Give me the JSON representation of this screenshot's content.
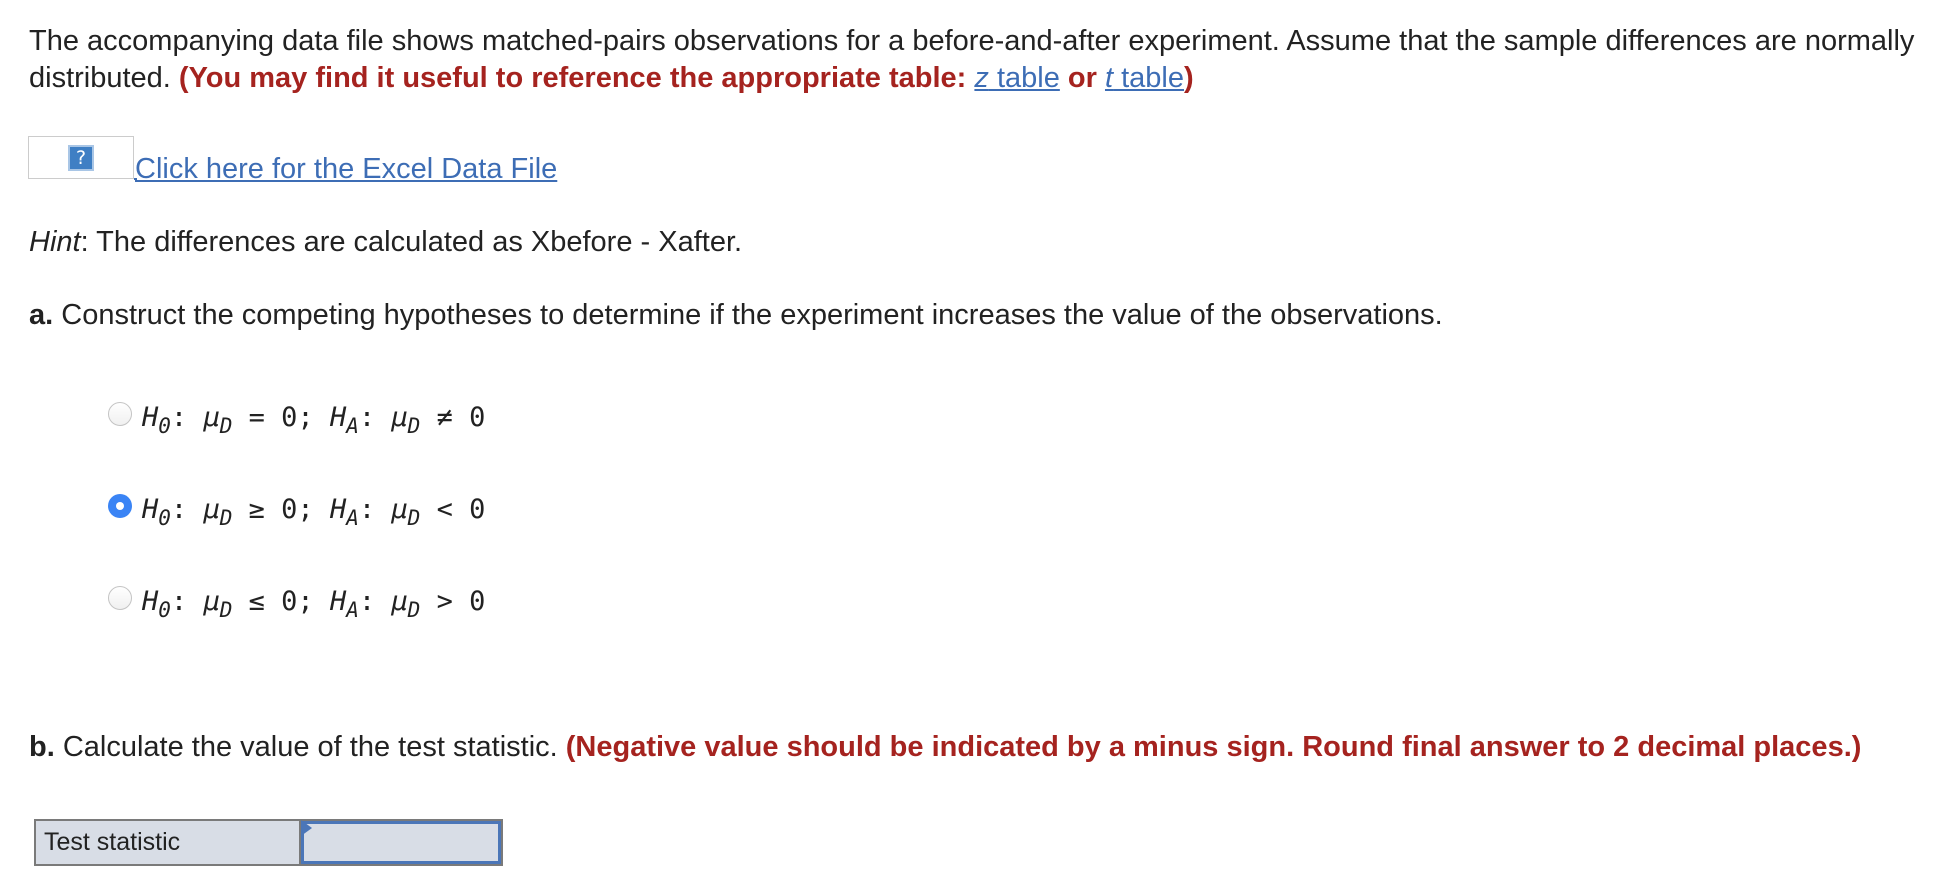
{
  "intro": {
    "text": "The accompanying data file shows matched-pairs observations for a before-and-after experiment. Assume that the sample differences are normally distributed. ",
    "note_prefix": "(You may find it useful to reference the appropriate table: ",
    "z_italic": "z",
    "z_link": " table",
    "or": " or ",
    "t_italic": "t",
    "t_link": " table",
    "note_suffix": ")"
  },
  "excel": {
    "icon": "?",
    "icon_name": "broken-image-icon",
    "link_label": "Click here for the Excel Data File"
  },
  "hint": {
    "label": "Hint",
    "text": ": The differences are calculated as Xbefore - Xafter."
  },
  "part_a": {
    "letter": "a.",
    "question": " Construct the competing hypotheses to determine if the experiment increases the value of the observations.",
    "selected_index": 1,
    "options": [
      {
        "h0_rel": "=",
        "ha_rel": "≠",
        "value": "0"
      },
      {
        "h0_rel": "≥",
        "ha_rel": "<",
        "value": "0"
      },
      {
        "h0_rel": "≤",
        "ha_rel": ">",
        "value": "0"
      }
    ],
    "symbols": {
      "H": "H",
      "sub0": "0",
      "subA": "A",
      "mu": "μ",
      "subD": "D",
      "colon": ": ",
      "sep": "; "
    }
  },
  "part_b": {
    "letter": "b.",
    "question": " Calculate the value of the test statistic. ",
    "instruction": "(Negative value should be indicated by a minus sign. Round final answer to 2 decimal places.)",
    "table_label": "Test statistic",
    "input_value": ""
  },
  "colors": {
    "instruction_red": "#a5231f",
    "link_blue": "#3d6db5",
    "radio_selected": "#3a84f5",
    "table_bg": "#d8dde6"
  }
}
